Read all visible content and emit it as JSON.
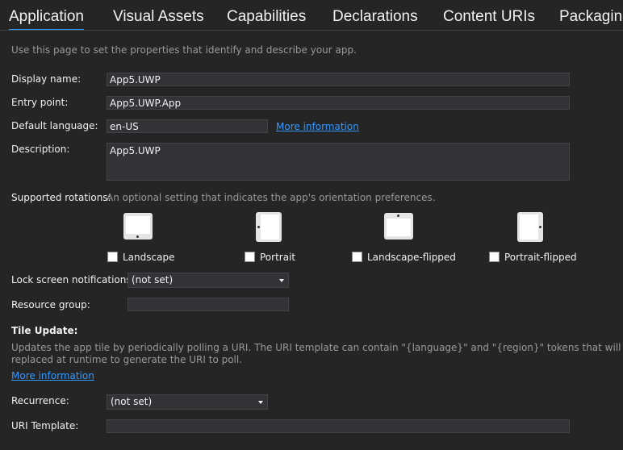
{
  "tabs": [
    {
      "label": "Application"
    },
    {
      "label": "Visual Assets"
    },
    {
      "label": "Capabilities"
    },
    {
      "label": "Declarations"
    },
    {
      "label": "Content URIs"
    },
    {
      "label": "Packaging"
    }
  ],
  "intro": "Use this page to set the properties that identify and describe your app.",
  "fields": {
    "display_name": {
      "label": "Display name:",
      "value": "App5.UWP"
    },
    "entry_point": {
      "label": "Entry point:",
      "value": "App5.UWP.App"
    },
    "default_language": {
      "label": "Default language:",
      "value": "en-US",
      "link": "More information"
    },
    "description": {
      "label": "Description:",
      "value": "App5.UWP"
    }
  },
  "rotations": {
    "label": "Supported rotations:",
    "hint": "An optional setting that indicates the app's orientation preferences.",
    "options": [
      {
        "label": "Landscape",
        "icon": "landscape-device-icon",
        "checked": false
      },
      {
        "label": "Portrait",
        "icon": "portrait-device-icon",
        "checked": false
      },
      {
        "label": "Landscape-flipped",
        "icon": "landscape-flipped-device-icon",
        "checked": false
      },
      {
        "label": "Portrait-flipped",
        "icon": "portrait-flipped-device-icon",
        "checked": false
      }
    ]
  },
  "lock_screen": {
    "label": "Lock screen notifications:",
    "value": "(not set)"
  },
  "resource_group": {
    "label": "Resource group:",
    "value": ""
  },
  "tile_update": {
    "heading": "Tile Update:",
    "line1": "Updates the app tile by periodically polling a URI. The URI template can contain \"{language}\" and \"{region}\" tokens that will be",
    "line2": "replaced at runtime to generate the URI to poll.",
    "link": "More information"
  },
  "recurrence": {
    "label": "Recurrence:",
    "value": "(not set)"
  },
  "uri_template": {
    "label": "URI Template:",
    "value": ""
  },
  "colors": {
    "background": "#252526",
    "accent": "#3399ff",
    "input_bg": "#333337",
    "hint": "#999999"
  }
}
